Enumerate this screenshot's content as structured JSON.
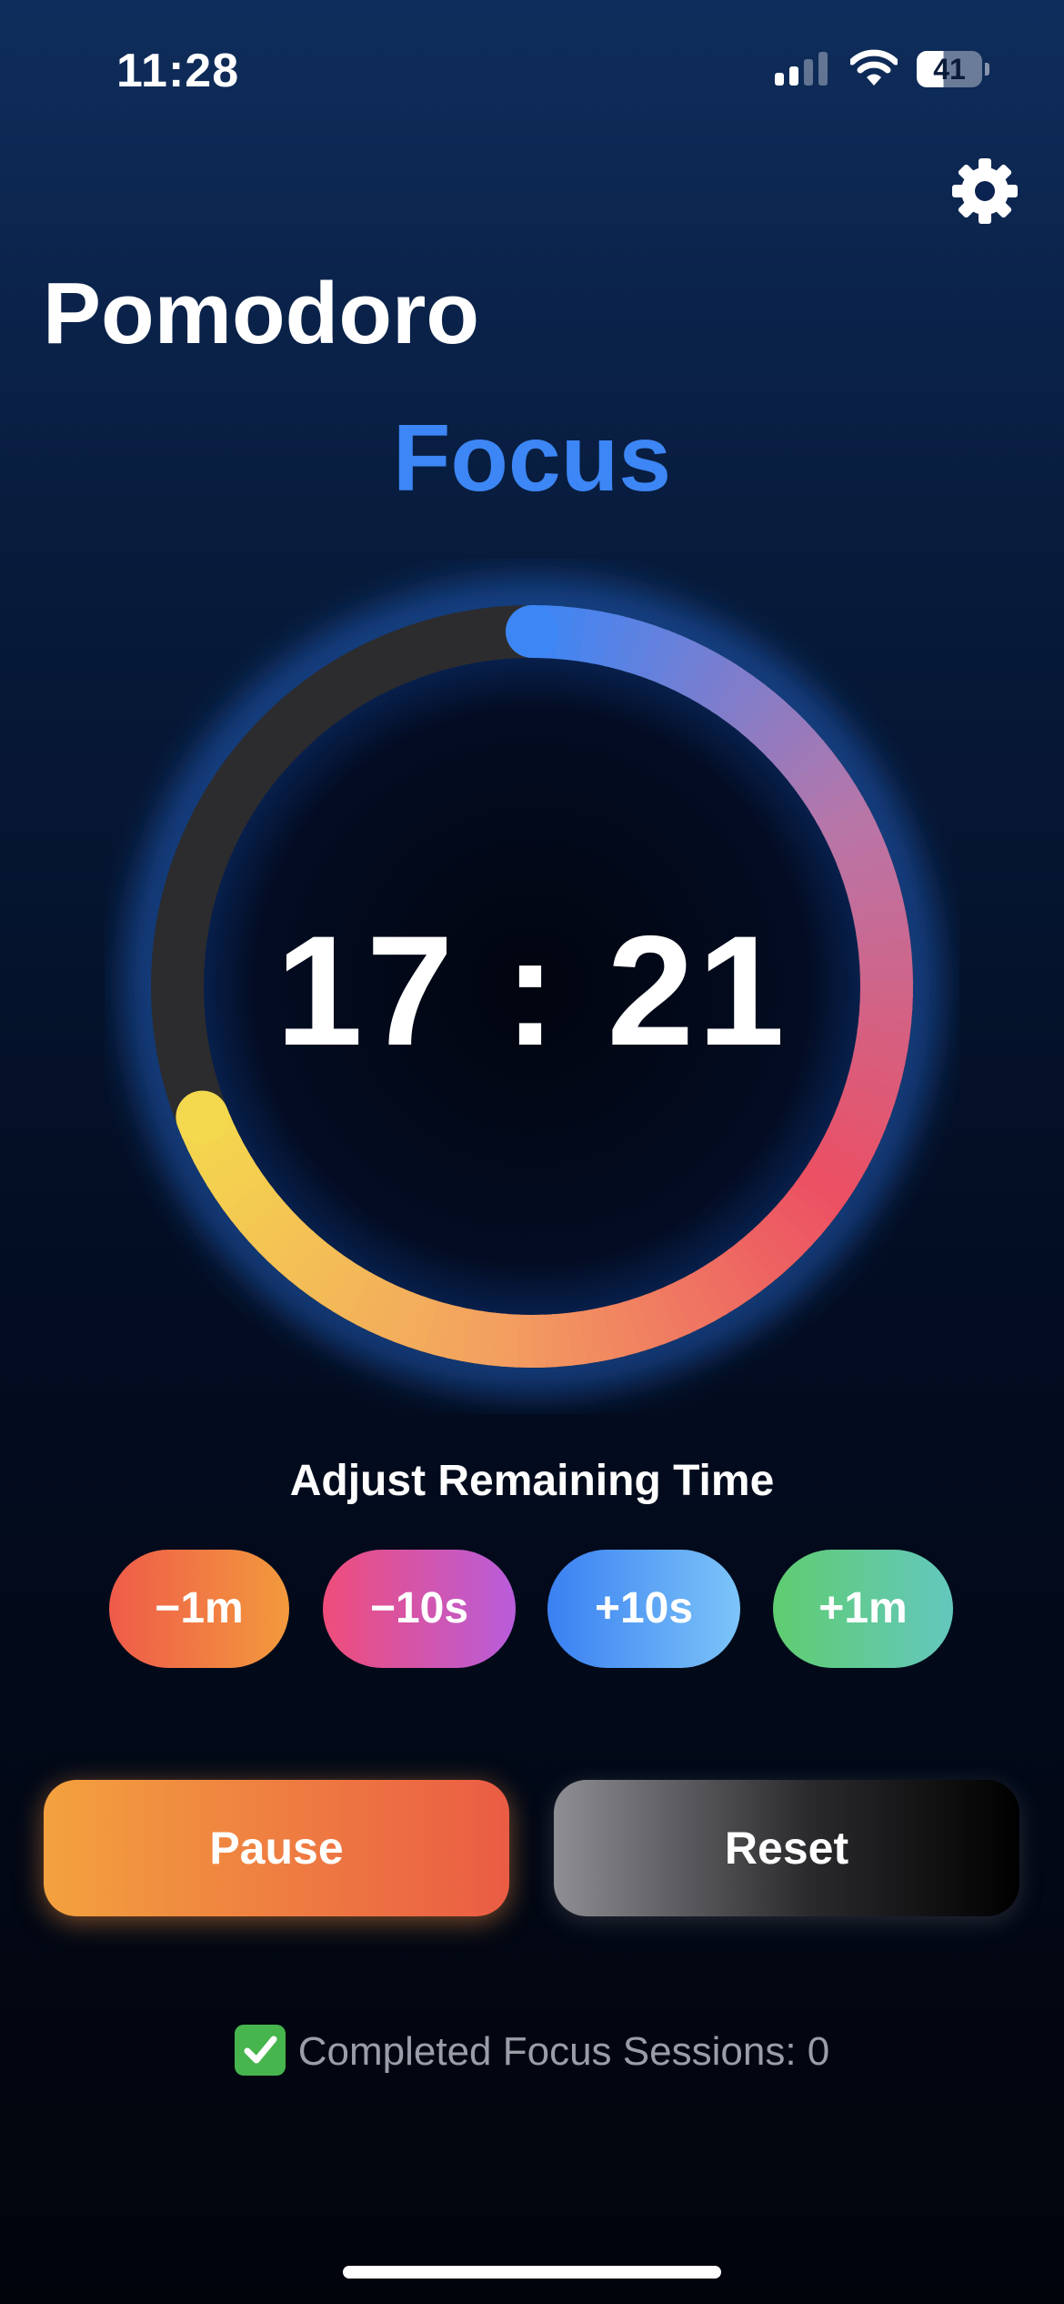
{
  "status_bar": {
    "time": "11:28",
    "battery_level": "41",
    "icons": [
      "signal-icon",
      "wifi-icon",
      "battery-icon"
    ]
  },
  "header": {
    "settings_icon": "gear-icon"
  },
  "app": {
    "title": "Pomodoro",
    "mode": "Focus",
    "mode_color": "#3d86f5"
  },
  "timer": {
    "minutes": "17",
    "seconds": "21",
    "remaining_fraction": 0.69,
    "ring_colors": [
      "#3d86f5",
      "#b876a8",
      "#ec4f63",
      "#f3a060",
      "#f4d84d"
    ],
    "track_color": "#2c2c2e"
  },
  "adjust": {
    "label": "Adjust Remaining Time",
    "buttons": [
      {
        "label": "−1m"
      },
      {
        "label": "−10s"
      },
      {
        "label": "+10s"
      },
      {
        "label": "+1m"
      }
    ]
  },
  "controls": {
    "pause_label": "Pause",
    "reset_label": "Reset"
  },
  "sessions": {
    "icon": "check-mark-icon",
    "text": "Completed Focus Sessions: 0"
  }
}
